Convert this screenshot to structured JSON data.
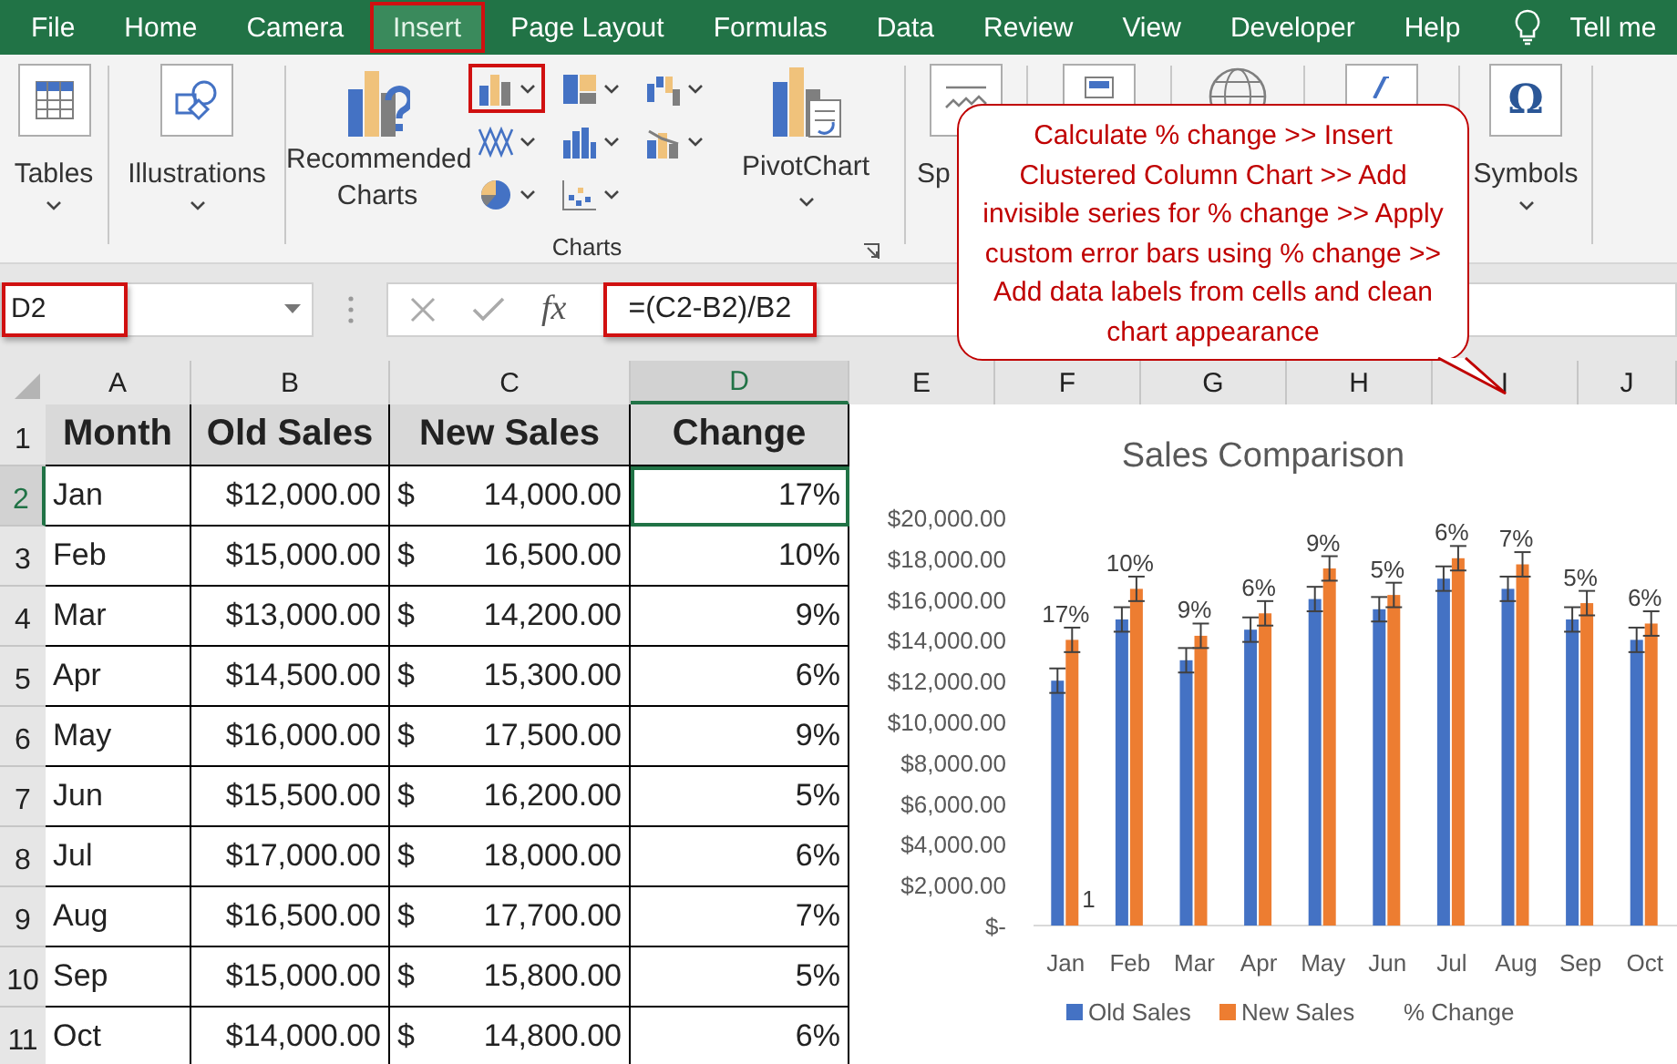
{
  "menu_tabs": [
    {
      "label": "File",
      "selected": false,
      "highlighted": false
    },
    {
      "label": "Home",
      "selected": false,
      "highlighted": false
    },
    {
      "label": "Camera",
      "selected": false,
      "highlighted": false
    },
    {
      "label": "Insert",
      "selected": true,
      "highlighted": true
    },
    {
      "label": "Page Layout",
      "selected": false,
      "highlighted": false
    },
    {
      "label": "Formulas",
      "selected": false,
      "highlighted": false
    },
    {
      "label": "Data",
      "selected": false,
      "highlighted": false
    },
    {
      "label": "Review",
      "selected": false,
      "highlighted": false
    },
    {
      "label": "View",
      "selected": false,
      "highlighted": false
    },
    {
      "label": "Developer",
      "selected": false,
      "highlighted": false
    },
    {
      "label": "Help",
      "selected": false,
      "highlighted": false
    }
  ],
  "tell_me": "Tell me",
  "ribbon": {
    "tables": {
      "label": "Tables"
    },
    "illustrations": {
      "label": "Illustrations"
    },
    "charts": {
      "recommended_label": "Recommended Charts",
      "pivot_label": "PivotChart",
      "group_label": "Charts",
      "column_chart_button": {
        "highlighted": true
      }
    },
    "sparklines": {
      "label": "Sp"
    },
    "symbols": {
      "glyph": "Ω",
      "label": "Symbols"
    }
  },
  "callout": {
    "text": "Calculate % change >> Insert Clustered Column Chart >> Add invisible series for % change >> Apply custom error bars using % change >> Add data labels from cells and clean chart appearance"
  },
  "name_box": {
    "value": "D2",
    "highlighted": true
  },
  "formula_bar": {
    "function_label": "fx",
    "value": "=(C2-B2)/B2",
    "highlighted": true
  },
  "columns": [
    {
      "label": "A",
      "selected": false
    },
    {
      "label": "B",
      "selected": false
    },
    {
      "label": "C",
      "selected": false
    },
    {
      "label": "D",
      "selected": true
    },
    {
      "label": "E",
      "selected": false
    },
    {
      "label": "F",
      "selected": false
    },
    {
      "label": "G",
      "selected": false
    },
    {
      "label": "H",
      "selected": false
    },
    {
      "label": "I",
      "selected": false
    },
    {
      "label": "J",
      "selected": false
    }
  ],
  "table": {
    "header_row": "1",
    "headers": [
      "Month",
      "Old Sales",
      "New Sales",
      "Change"
    ],
    "rows": [
      {
        "row": "2",
        "month": "Jan",
        "old": "$12,000.00",
        "currency": "$",
        "new": "14,000.00",
        "change": "17%",
        "selected": true
      },
      {
        "row": "3",
        "month": "Feb",
        "old": "$15,000.00",
        "currency": "$",
        "new": "16,500.00",
        "change": "10%",
        "selected": false
      },
      {
        "row": "4",
        "month": "Mar",
        "old": "$13,000.00",
        "currency": "$",
        "new": "14,200.00",
        "change": "9%",
        "selected": false
      },
      {
        "row": "5",
        "month": "Apr",
        "old": "$14,500.00",
        "currency": "$",
        "new": "15,300.00",
        "change": "6%",
        "selected": false
      },
      {
        "row": "6",
        "month": "May",
        "old": "$16,000.00",
        "currency": "$",
        "new": "17,500.00",
        "change": "9%",
        "selected": false
      },
      {
        "row": "7",
        "month": "Jun",
        "old": "$15,500.00",
        "currency": "$",
        "new": "16,200.00",
        "change": "5%",
        "selected": false
      },
      {
        "row": "8",
        "month": "Jul",
        "old": "$17,000.00",
        "currency": "$",
        "new": "18,000.00",
        "change": "6%",
        "selected": false
      },
      {
        "row": "9",
        "month": "Aug",
        "old": "$16,500.00",
        "currency": "$",
        "new": "17,700.00",
        "change": "7%",
        "selected": false
      },
      {
        "row": "10",
        "month": "Sep",
        "old": "$15,000.00",
        "currency": "$",
        "new": "15,800.00",
        "change": "5%",
        "selected": false
      },
      {
        "row": "11",
        "month": "Oct",
        "old": "$14,000.00",
        "currency": "$",
        "new": "14,800.00",
        "change": "6%",
        "selected": false
      }
    ]
  },
  "chart": {
    "chart_data": {
      "type": "bar",
      "title": "Sales Comparison",
      "categories": [
        "Jan",
        "Feb",
        "Mar",
        "Apr",
        "May",
        "Jun",
        "Jul",
        "Aug",
        "Sep",
        "Oct"
      ],
      "series": [
        {
          "name": "Old Sales",
          "color": "#4472c4",
          "values": [
            12000,
            15000,
            13000,
            14500,
            16000,
            15500,
            17000,
            16500,
            15000,
            14000
          ]
        },
        {
          "name": "New Sales",
          "color": "#ed7d31",
          "values": [
            14000,
            16500,
            14200,
            15300,
            17500,
            16200,
            18000,
            17700,
            15800,
            14800
          ]
        },
        {
          "name": "% Change",
          "color": null,
          "values": [
            null,
            null,
            null,
            null,
            null,
            null,
            null,
            null,
            null,
            null
          ]
        }
      ],
      "ylim": [
        0,
        20000
      ],
      "yticks": [
        {
          "value": 0,
          "label": "$-"
        },
        {
          "value": 2000,
          "label": "$2,000.00"
        },
        {
          "value": 4000,
          "label": "$4,000.00"
        },
        {
          "value": 6000,
          "label": "$6,000.00"
        },
        {
          "value": 8000,
          "label": "$8,000.00"
        },
        {
          "value": 10000,
          "label": "$10,000.00"
        },
        {
          "value": 12000,
          "label": "$12,000.00"
        },
        {
          "value": 14000,
          "label": "$14,000.00"
        },
        {
          "value": 16000,
          "label": "$16,000.00"
        },
        {
          "value": 18000,
          "label": "$18,000.00"
        },
        {
          "value": 20000,
          "label": "$20,000.00"
        }
      ],
      "value_labels": [
        "17%",
        "10%",
        "9%",
        "6%",
        "9%",
        "5%",
        "6%",
        "7%",
        "5%",
        "6%"
      ],
      "annotations": [
        {
          "x": "Jan",
          "text": "1"
        }
      ],
      "legend": "bottom"
    }
  }
}
